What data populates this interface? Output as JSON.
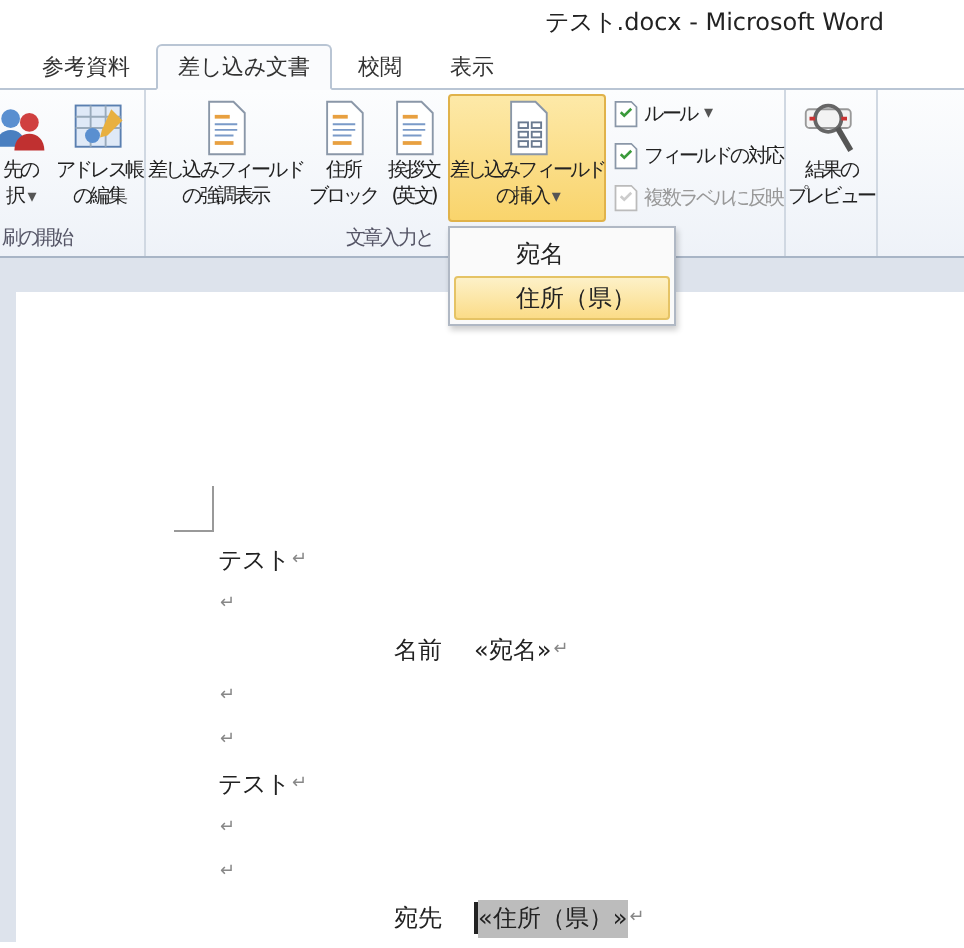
{
  "window": {
    "title": "テスト.docx - Microsoft Word"
  },
  "tabs": [
    {
      "label": "参考資料",
      "selected": false
    },
    {
      "label": "差し込み文書",
      "selected": true
    },
    {
      "label": "校閲",
      "selected": false
    },
    {
      "label": "表示",
      "selected": false
    }
  ],
  "ribbon": {
    "groups": [
      {
        "label": "刷の開始",
        "buttons": [
          {
            "lines": [
              "先の",
              "択"
            ],
            "caret": "▾",
            "pressed": false
          },
          {
            "lines": [
              "アドレス帳",
              "の編集"
            ],
            "pressed": false
          }
        ]
      },
      {
        "label": "文章入力と",
        "buttons": [
          {
            "lines": [
              "差し込みフィールド",
              "の強調表示"
            ],
            "pressed": false
          },
          {
            "lines": [
              "住所",
              "ブロック"
            ],
            "pressed": false
          },
          {
            "lines": [
              "挨拶文",
              "(英文)"
            ],
            "pressed": false
          },
          {
            "lines": [
              "差し込みフィールド",
              "の挿入"
            ],
            "caret": "▾",
            "pressed": true
          }
        ],
        "small_buttons": [
          {
            "label": "ルール",
            "caret": "▾",
            "disabled": false
          },
          {
            "label": "フィールドの対応",
            "disabled": false
          },
          {
            "label": "複数ラベルに反映",
            "disabled": true
          }
        ]
      },
      {
        "buttons": [
          {
            "lines": [
              "結果の",
              "プレビュー"
            ],
            "pressed": false
          }
        ]
      }
    ]
  },
  "menu": {
    "items": [
      {
        "label": "宛名",
        "selected": false
      },
      {
        "label": "住所（県）",
        "selected": true
      }
    ]
  },
  "document": {
    "paragraphs": [
      {
        "kind": "text",
        "text": "テスト",
        "mark": "↵"
      },
      {
        "kind": "empty",
        "mark": "↵"
      },
      {
        "kind": "field",
        "label": "名前",
        "field": "«宛名»",
        "mark": "↵",
        "shaded": false
      },
      {
        "kind": "empty",
        "mark": "↵"
      },
      {
        "kind": "empty",
        "mark": "↵"
      },
      {
        "kind": "text",
        "text": "テスト",
        "mark": "↵"
      },
      {
        "kind": "empty",
        "mark": "↵"
      },
      {
        "kind": "empty",
        "mark": "↵"
      },
      {
        "kind": "field",
        "label": "宛先",
        "field": "«住所（県）»",
        "mark": "↵",
        "shaded": true,
        "cursor": true
      }
    ]
  }
}
